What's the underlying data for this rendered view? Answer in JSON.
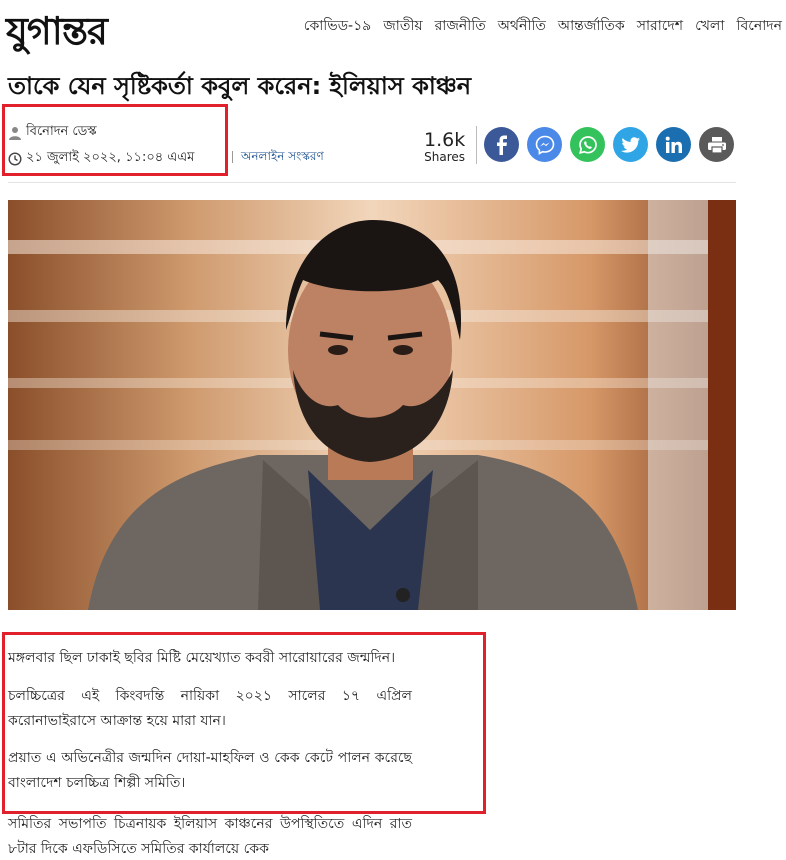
{
  "header": {
    "logo": "যুগান্তর",
    "nav": [
      "কোভিড-১৯",
      "জাতীয়",
      "রাজনীতি",
      "অর্থনীতি",
      "আন্তর্জাতিক",
      "সারাদেশ",
      "খেলা",
      "বিনোদন"
    ]
  },
  "article": {
    "headline": "তাকে যেন সৃষ্টিকর্তা কবুল করেন: ইলিয়াস কাঞ্চন",
    "author": "বিনোদন ডেস্ক",
    "date": "২১ জুলাই ২০২২, ১১:০৪ এএম",
    "online_edition": "অনলাইন সংস্করণ",
    "share_count": "1.6k",
    "share_label": "Shares",
    "paragraphs": [
      "মঙ্গলবার ছিল ঢাকাই ছবির মিষ্টি মেয়েখ্যাত কবরী সারোয়ারের জন্মদিন।",
      "চলচ্চিত্রের এই কিংবদন্তি নায়িকা ২০২১ সালের ১৭ এপ্রিল করোনাভাইরাসে আক্রান্ত হয়ে মারা যান।",
      "প্রয়াত এ অভিনেত্রীর জন্মদিন দোয়া-মাহফিল ও কেক কেটে পালন করেছে বাংলাদেশ চলচ্চিত্র শিল্পী সমিতি।",
      "সমিতির সভাপতি চিত্রনায়ক ইলিয়াস কাঞ্চনের উপস্থিতিতে এদিন রাত ৮টার দিকে এফডিসিতে সমিতির কার্যালয়ে কেক"
    ]
  },
  "social": {
    "facebook": "f",
    "messenger": "m",
    "whatsapp": "w",
    "twitter": "t",
    "linkedin": "in",
    "print": "p"
  },
  "colors": {
    "highlight": "#e0202a",
    "facebook": "#3b5998",
    "messenger": "#4b89e8",
    "whatsapp": "#33c25b",
    "twitter": "#2fa5e6",
    "linkedin": "#1b6fb0",
    "print": "#5a5a5a"
  }
}
